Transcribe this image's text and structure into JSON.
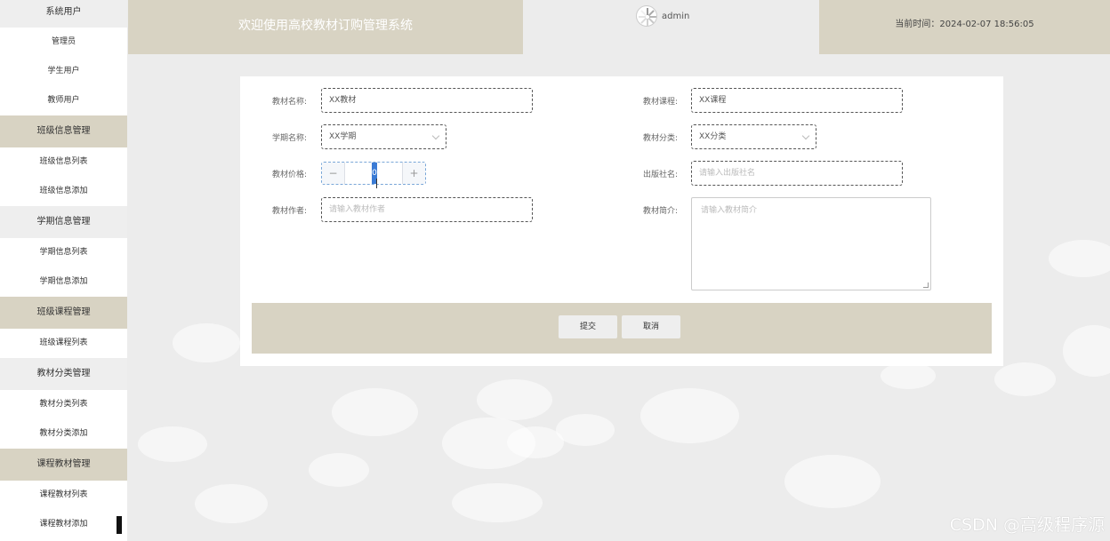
{
  "sidebar": {
    "top_item": "系统用户",
    "items": [
      {
        "type": "item",
        "label": "管理员"
      },
      {
        "type": "item",
        "label": "学生用户"
      },
      {
        "type": "item",
        "label": "教师用户"
      },
      {
        "type": "group",
        "label": "班级信息管理"
      },
      {
        "type": "item",
        "label": "班级信息列表"
      },
      {
        "type": "item",
        "label": "班级信息添加"
      },
      {
        "type": "group-light",
        "label": "学期信息管理"
      },
      {
        "type": "item",
        "label": "学期信息列表"
      },
      {
        "type": "item",
        "label": "学期信息添加"
      },
      {
        "type": "group",
        "label": "班级课程管理"
      },
      {
        "type": "item",
        "label": "班级课程列表"
      },
      {
        "type": "group-light",
        "label": "教材分类管理"
      },
      {
        "type": "item",
        "label": "教材分类列表"
      },
      {
        "type": "item",
        "label": "教材分类添加"
      },
      {
        "type": "group",
        "label": "课程教材管理"
      },
      {
        "type": "item",
        "label": "课程教材列表"
      },
      {
        "type": "item",
        "label": "课程教材添加"
      }
    ]
  },
  "header": {
    "title": "欢迎使用高校教材订购管理系统",
    "user": "admin",
    "time_label": "当前时间：",
    "time_value": "2024-02-07 18:56:05"
  },
  "form": {
    "name_label": "教材名称:",
    "name_value": "XX教材",
    "course_label": "教材课程:",
    "course_value": "XX课程",
    "term_label": "学期名称:",
    "term_value": "XX学期",
    "category_label": "教材分类:",
    "category_value": "XX分类",
    "price_label": "教材价格:",
    "price_value": "0",
    "price_minus": "−",
    "price_plus": "+",
    "publisher_label": "出版社名:",
    "publisher_placeholder": "请输入出版社名",
    "author_label": "教材作者:",
    "author_placeholder": "请输入教材作者",
    "intro_label": "教材简介:",
    "intro_placeholder": "请输入教材简介"
  },
  "actions": {
    "submit": "提交",
    "cancel": "取消"
  },
  "watermark": "CSDN @高级程序源",
  "colors": {
    "accent": "#d8d3c3",
    "background": "#ececec",
    "selection": "#3a7bd5"
  }
}
